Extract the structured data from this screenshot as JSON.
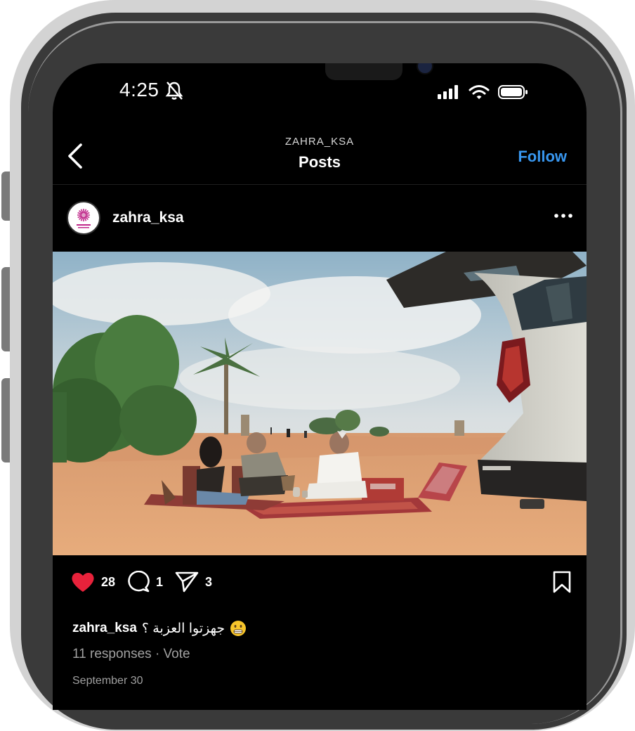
{
  "status_bar": {
    "time": "4:25"
  },
  "header": {
    "subtitle": "ZAHRA_KSA",
    "title": "Posts",
    "follow_label": "Follow"
  },
  "post": {
    "username": "zahra_ksa",
    "caption_user": "zahra_ksa",
    "caption_text": "جهزتوا العزبة ؟",
    "likes": "28",
    "comments": "1",
    "shares": "3",
    "responses": "11 responses · Vote",
    "date": "September 30"
  },
  "icons": {
    "back": "chevron-left-icon",
    "bell_muted": "bell-slash-icon",
    "signal": "signal-icon",
    "wifi": "wifi-icon",
    "battery": "battery-icon",
    "more": "more-horizontal-icon",
    "like": "heart-filled-icon",
    "comment": "comment-icon",
    "share": "send-icon",
    "bookmark": "bookmark-icon",
    "emoji": "grimace-emoji-icon"
  },
  "colors": {
    "like": "#e8223b",
    "follow": "#3897f0",
    "background": "#000000"
  }
}
